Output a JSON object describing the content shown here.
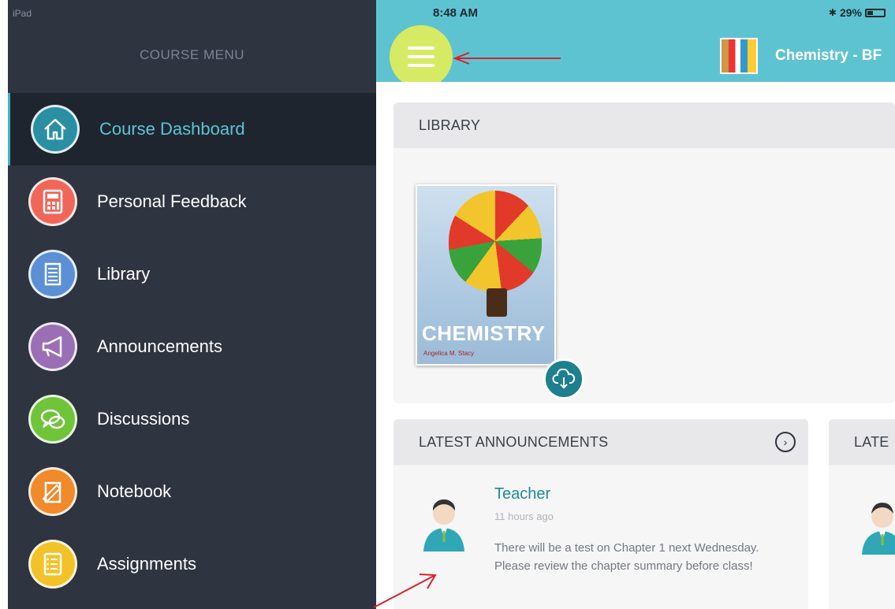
{
  "status": {
    "device": "iPad",
    "time": "8:48 AM",
    "battery": "29%"
  },
  "sidebar": {
    "title": "COURSE MENU",
    "items": [
      {
        "label": "Course Dashboard",
        "icon": "home-icon",
        "color": "#2a8fa3",
        "active": true
      },
      {
        "label": "Personal Feedback",
        "icon": "calculator-icon",
        "color": "#f0675a"
      },
      {
        "label": "Library",
        "icon": "book-stack-icon",
        "color": "#5b8fd6"
      },
      {
        "label": "Announcements",
        "icon": "megaphone-icon",
        "color": "#9a6fb6"
      },
      {
        "label": "Discussions",
        "icon": "chat-bubbles-icon",
        "color": "#6fc43a"
      },
      {
        "label": "Notebook",
        "icon": "notebook-icon",
        "color": "#f08a2a"
      },
      {
        "label": "Assignments",
        "icon": "checklist-icon",
        "color": "#f2c228"
      }
    ]
  },
  "header": {
    "course_title": "Chemistry - BF"
  },
  "library": {
    "heading": "LIBRARY",
    "book": {
      "title": "CHEMISTRY",
      "author": "Angelica M. Stacy"
    }
  },
  "announcements": {
    "heading": "LATEST ANNOUNCEMENTS",
    "item": {
      "author": "Teacher",
      "time": "11 hours ago",
      "body": "There will be a test on Chapter 1 next Wednesday. Please review the chapter summary before class!"
    }
  },
  "second_card": {
    "heading": "LATE"
  },
  "colors": {
    "accent": "#5ec3d1",
    "sidebar_bg": "#2e3440",
    "hamburger": "#d7ea63",
    "arrow": "#d6222a"
  }
}
